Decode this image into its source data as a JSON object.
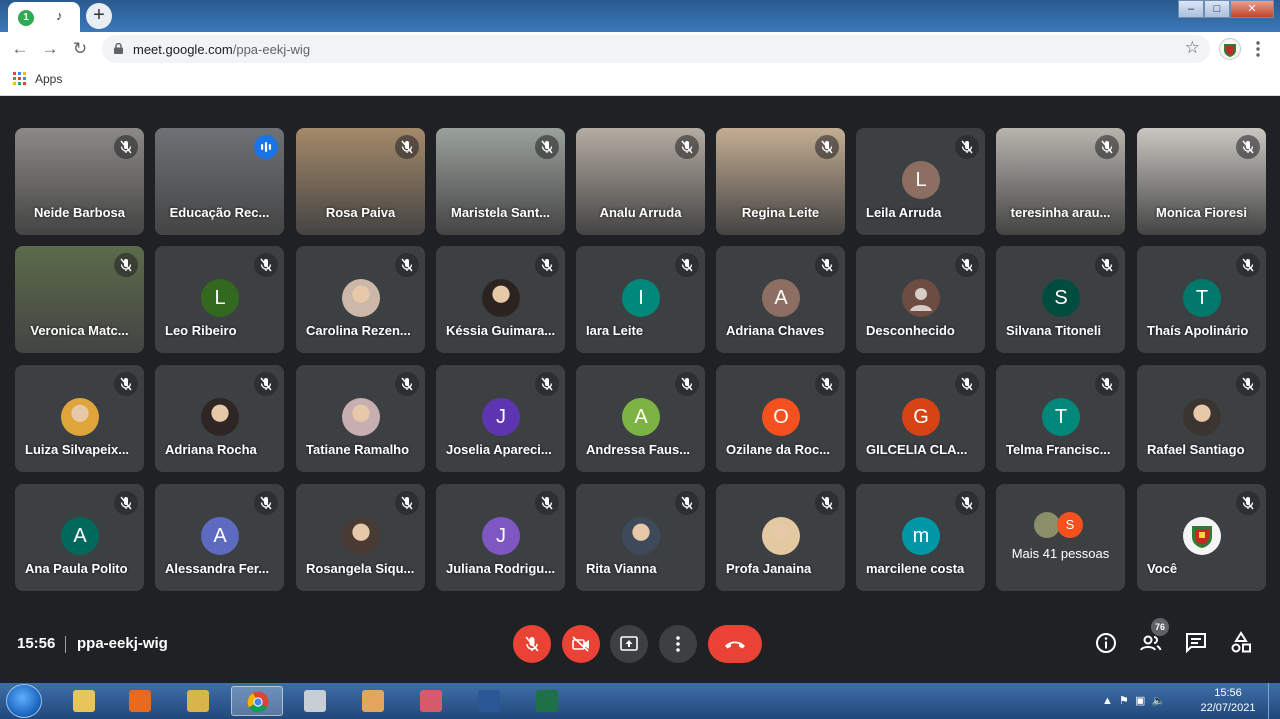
{
  "browser": {
    "tab_count": "1",
    "url_host": "meet.google.com",
    "url_path": "/ppa-eekj-wig",
    "bookmarks_apps_label": "Apps"
  },
  "participants": [
    {
      "name": "Neide Barbosa",
      "type": "video",
      "muted": true,
      "bg": "#8c8a86"
    },
    {
      "name": "Educação Rec...",
      "type": "video",
      "muted": false,
      "speaking": true,
      "bg": "#6e7175"
    },
    {
      "name": "Rosa Paiva",
      "type": "video",
      "muted": true,
      "bg": "#a5896a"
    },
    {
      "name": "Maristela Sant...",
      "type": "video",
      "muted": true,
      "bg": "#9aa19c"
    },
    {
      "name": "Analu Arruda",
      "type": "video",
      "muted": true,
      "bg": "#b5aca2"
    },
    {
      "name": "Regina Leite",
      "type": "video",
      "muted": true,
      "bg": "#c3ad92"
    },
    {
      "name": "Leila Arruda",
      "type": "initial",
      "initial": "L",
      "color": "#8d6e63",
      "muted": true
    },
    {
      "name": "teresinha arau...",
      "type": "video",
      "muted": true,
      "bg": "#b8b5ae"
    },
    {
      "name": "Monica Fioresi",
      "type": "video",
      "muted": true,
      "bg": "#c9c7c1"
    },
    {
      "name": "Veronica Matc...",
      "type": "video",
      "muted": true,
      "bg": "#5c6b4a"
    },
    {
      "name": "Leo Ribeiro",
      "type": "initial",
      "initial": "L",
      "color": "#33691e",
      "muted": true
    },
    {
      "name": "Carolina Rezen...",
      "type": "photo",
      "color": "#cbb8a8",
      "muted": true
    },
    {
      "name": "Késsia Guimara...",
      "type": "photo",
      "color": "#2b2320",
      "muted": true
    },
    {
      "name": "Iara Leite",
      "type": "initial",
      "initial": "I",
      "color": "#00897b",
      "muted": true
    },
    {
      "name": "Adriana Chaves",
      "type": "initial",
      "initial": "A",
      "color": "#8d6e63",
      "muted": true
    },
    {
      "name": "Desconhecido",
      "type": "anon",
      "color": "#6d4c41",
      "muted": true
    },
    {
      "name": "Silvana Titoneli",
      "type": "initial",
      "initial": "S",
      "color": "#004d40",
      "muted": true
    },
    {
      "name": "Thaís Apolinário",
      "type": "initial",
      "initial": "T",
      "color": "#00796b",
      "muted": true
    },
    {
      "name": "Luiza Silvapeix...",
      "type": "photo",
      "color": "#e0a53a",
      "muted": true
    },
    {
      "name": "Adriana Rocha",
      "type": "photo",
      "color": "#2d2624",
      "muted": true
    },
    {
      "name": "Tatiane Ramalho",
      "type": "photo",
      "color": "#c7aeb0",
      "muted": true
    },
    {
      "name": "Joselia Apareci...",
      "type": "initial",
      "initial": "J",
      "color": "#5e35b1",
      "muted": true
    },
    {
      "name": "Andressa Faus...",
      "type": "initial",
      "initial": "A",
      "color": "#7cb342",
      "muted": true
    },
    {
      "name": "Ozilane da Roc...",
      "type": "initial",
      "initial": "O",
      "color": "#f4511e",
      "muted": true
    },
    {
      "name": "GILCELIA CLA...",
      "type": "initial",
      "initial": "G",
      "color": "#d84315",
      "muted": true
    },
    {
      "name": "Telma Francisc...",
      "type": "initial",
      "initial": "T",
      "color": "#00897b",
      "muted": true
    },
    {
      "name": "Rafael Santiago",
      "type": "photo",
      "color": "#3b3532",
      "muted": true
    },
    {
      "name": "Ana Paula Polito",
      "type": "initial",
      "initial": "A",
      "color": "#00695c",
      "muted": true
    },
    {
      "name": "Alessandra Fer...",
      "type": "initial",
      "initial": "A",
      "color": "#5c6bc0",
      "muted": true
    },
    {
      "name": "Rosangela Siqu...",
      "type": "photo",
      "color": "#4a3a34",
      "muted": true
    },
    {
      "name": "Juliana Rodrigu...",
      "type": "initial",
      "initial": "J",
      "color": "#7e57c2",
      "muted": true
    },
    {
      "name": "Rita Vianna",
      "type": "photo",
      "color": "#3e4a5a",
      "muted": true
    },
    {
      "name": "Profa Janaina",
      "type": "photo",
      "color": "#e2c9a2",
      "muted": true
    },
    {
      "name": "marcilene costa",
      "type": "initial",
      "initial": "m",
      "color": "#0097a7",
      "muted": true
    },
    {
      "name": "Mais 41 pessoas",
      "type": "more",
      "muted": false,
      "mini": [
        {
          "color": "#8a8f6a",
          "initial": ""
        },
        {
          "color": "#f4511e",
          "initial": "S"
        }
      ]
    },
    {
      "name": "Você",
      "type": "crest",
      "muted": true
    }
  ],
  "bottom_bar": {
    "time": "15:56",
    "meeting_code": "ppa-eekj-wig",
    "participant_count": "76"
  },
  "taskbar": {
    "clock_time": "15:56",
    "clock_date": "22/07/2021"
  },
  "colors": {
    "meet_bg": "#202124",
    "tile_bg": "#3c4043",
    "red_control": "#ea4335",
    "speaking_outline": "#8ab4f8"
  }
}
